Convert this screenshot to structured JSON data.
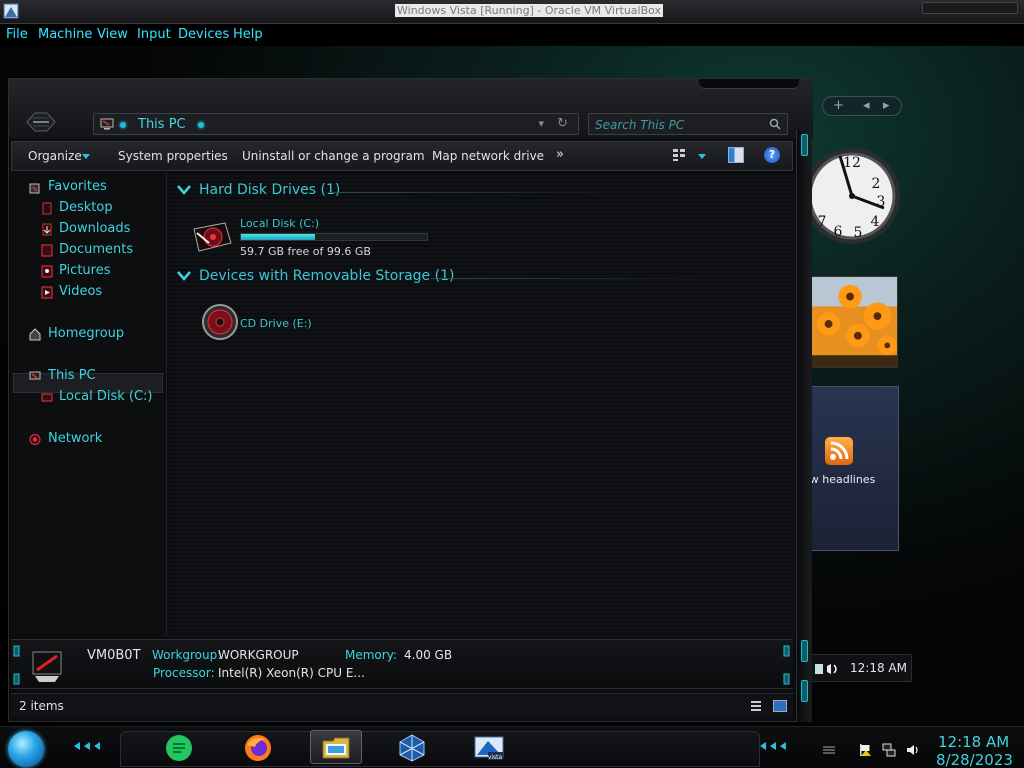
{
  "host": {
    "title": "Windows Vista [Running] - Oracle VM VirtualBox",
    "menu": [
      "File",
      "Machine",
      "View",
      "Input",
      "Devices",
      "Help"
    ]
  },
  "explorer": {
    "address": "This PC",
    "search_placeholder": "Search This PC",
    "commands": {
      "organize": "Organize",
      "system_properties": "System properties",
      "uninstall": "Uninstall or change a program",
      "map_drive": "Map network drive",
      "more": "»",
      "help": "?"
    },
    "nav": {
      "favorites": "Favorites",
      "desktop": "Desktop",
      "downloads": "Downloads",
      "documents": "Documents",
      "pictures": "Pictures",
      "videos": "Videos",
      "homegroup": "Homegroup",
      "this_pc": "This PC",
      "local_disk": "Local Disk (C:)",
      "network": "Network"
    },
    "groups": {
      "hard_disks": "Hard Disk Drives (1)",
      "removable": "Devices with Removable Storage (1)"
    },
    "drive_c": {
      "label": "Local Disk (C:)",
      "free_text": "59.7 GB free of 99.6 GB",
      "used_fraction": 0.4
    },
    "cd_drive": {
      "label": "CD Drive (E:)"
    },
    "details": {
      "name": "VM0B0T",
      "workgroup_label": "Workgroup:",
      "workgroup_value": "WORKGROUP",
      "memory_label": "Memory:",
      "memory_value": "4.00 GB",
      "processor_label": "Processor:",
      "processor_value": "Intel(R) Xeon(R) CPU E..."
    },
    "status": {
      "items": "2 items"
    }
  },
  "gadgets": {
    "feeds_label": "ew headlines",
    "ctrl_plus": "+",
    "ctrl_prev": "◂",
    "ctrl_next": "▸"
  },
  "guest_tray_overlay": {
    "time": "12:18 AM"
  },
  "taskbar": {
    "time": "12:18 AM",
    "date": "8/28/2023",
    "apps": [
      "messaging-app",
      "firefox",
      "windows-explorer",
      "virtualbox",
      "vista"
    ]
  },
  "colors": {
    "accent": "#3fd3df",
    "text": "#e2e2e2",
    "window_bg": "#0b0c0e"
  }
}
